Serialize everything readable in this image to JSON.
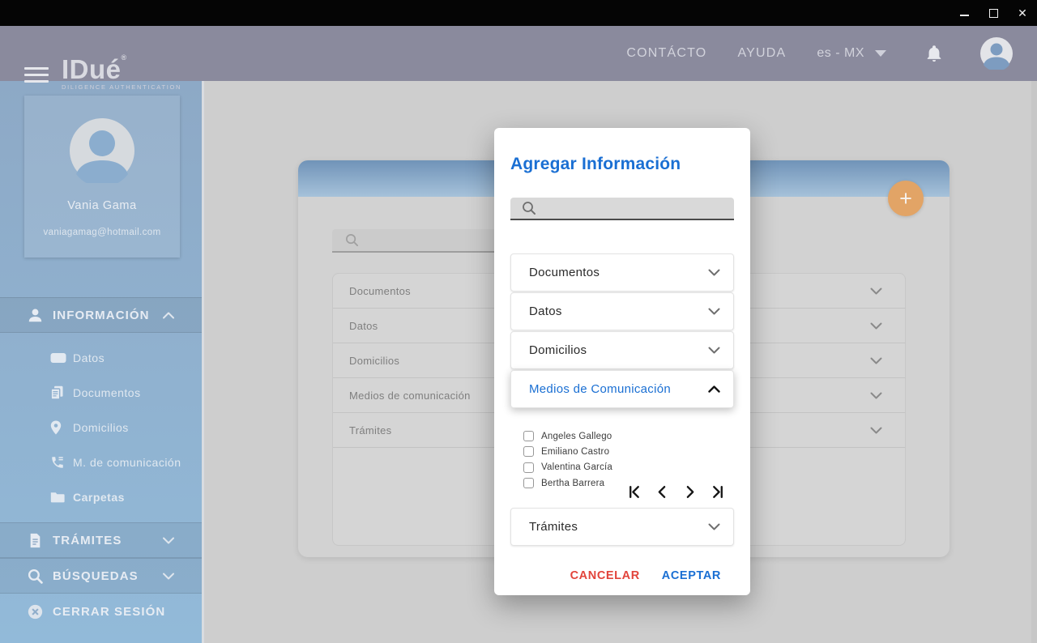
{
  "titlebar": {
    "close_icon": "✕"
  },
  "header": {
    "brand": "IDué",
    "brand_registered": "®",
    "brand_subtitle": "DILIGENCE AUTHENTICATION",
    "nav_contact": "CONTÁCTO",
    "nav_help": "AYUDA",
    "locale": "es - MX"
  },
  "sidebar": {
    "user": {
      "name": "Vania Gama",
      "email": "vaniagamag@hotmail.com"
    },
    "section_informacion": "INFORMACIÓN",
    "items": [
      {
        "label": "Datos",
        "icon": "card-icon"
      },
      {
        "label": "Documentos",
        "icon": "documents-icon"
      },
      {
        "label": "Domicilios",
        "icon": "location-pin-icon"
      },
      {
        "label": "M. de comunicación",
        "icon": "phone-icon"
      },
      {
        "label": "Carpetas",
        "icon": "folder-icon",
        "active": true
      }
    ],
    "section_tramites": "TRÁMITES",
    "section_busquedas": "BÚSQUEDAS",
    "logout": "CERRAR SESIÓN"
  },
  "content": {
    "fab_icon": "+",
    "rows": [
      {
        "label": "Documentos"
      },
      {
        "label": "Datos"
      },
      {
        "label": "Domicilios"
      },
      {
        "label": "Medios de comunicación"
      },
      {
        "label": "Trámites"
      }
    ]
  },
  "modal": {
    "title": "Agregar Información",
    "accordions": [
      {
        "label": "Documentos",
        "expanded": false
      },
      {
        "label": "Datos",
        "expanded": false
      },
      {
        "label": "Domicilios",
        "expanded": false
      },
      {
        "label": "Medios de Comunicación",
        "expanded": true
      },
      {
        "label": "Trámites",
        "expanded": false
      }
    ],
    "options": [
      {
        "label": "Angeles Gallego",
        "checked": false
      },
      {
        "label": "Emiliano Castro",
        "checked": false
      },
      {
        "label": "Valentina García",
        "checked": false
      },
      {
        "label": "Bertha Barrera",
        "checked": false
      }
    ],
    "pagination": [
      "first-page",
      "previous-page",
      "next-page",
      "last-page"
    ],
    "cancel_label": "CANCELAR",
    "accept_label": "ACEPTAR"
  },
  "colors": {
    "accent_blue": "#1a6fd3",
    "cancel_red": "#e2443b",
    "fab_orange": "#e2a466",
    "header_gray": "#8a8a9d",
    "sidebar_blue": "#90aecb"
  }
}
